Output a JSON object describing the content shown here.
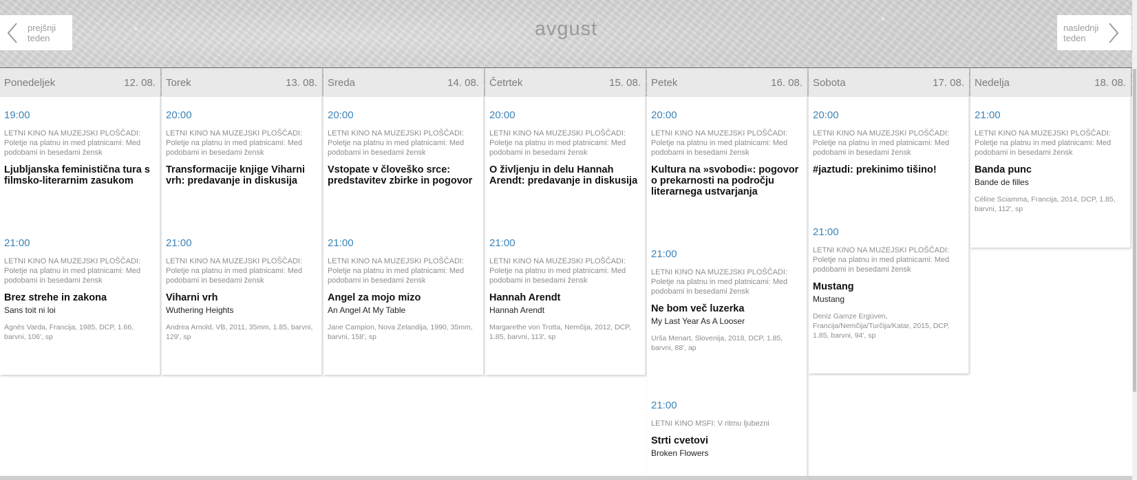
{
  "month": "avgust",
  "nav": {
    "prev_line1": "prejšnji",
    "prev_line2": "teden",
    "next_line1": "naslednji",
    "next_line2": "teden"
  },
  "days": [
    {
      "name": "Ponedeljek",
      "date": "12. 08.",
      "events": [
        {
          "time": "19:00",
          "series": "LETNI KINO NA MUZEJSKI PLOŠČADI: Poletje na platnu in med platnicami: Med podobami in besedami žensk",
          "title": "Ljubljanska feministična tura s filmsko-literarnim zasukom",
          "orig": "",
          "info": ""
        },
        {
          "time": "21:00",
          "series": "LETNI KINO NA MUZEJSKI PLOŠČADI: Poletje na platnu in med platnicami: Med podobami in besedami žensk",
          "title": "Brez strehe in zakona",
          "orig": "Sans toit ni loi",
          "info": "Agnès Varda, Francija, 1985, DCP, 1.66, barvni, 106', sp"
        }
      ]
    },
    {
      "name": "Torek",
      "date": "13. 08.",
      "events": [
        {
          "time": "20:00",
          "series": "LETNI KINO NA MUZEJSKI PLOŠČADI: Poletje na platnu in med platnicami: Med podobami in besedami žensk",
          "title": "Transformacije knjige Viharni vrh: predavanje in diskusija",
          "orig": "",
          "info": ""
        },
        {
          "time": "21:00",
          "series": "LETNI KINO NA MUZEJSKI PLOŠČADI: Poletje na platnu in med platnicami: Med podobami in besedami žensk",
          "title": "Viharni vrh",
          "orig": "Wuthering Heights",
          "info": "Andrea Arnold, VB, 2011, 35mm, 1.85, barvni, 129', sp"
        }
      ]
    },
    {
      "name": "Sreda",
      "date": "14. 08.",
      "events": [
        {
          "time": "20:00",
          "series": "LETNI KINO NA MUZEJSKI PLOŠČADI: Poletje na platnu in med platnicami: Med podobami in besedami žensk",
          "title": "Vstopate v človeško srce: predstavitev zbirke in pogovor",
          "orig": "",
          "info": ""
        },
        {
          "time": "21:00",
          "series": "LETNI KINO NA MUZEJSKI PLOŠČADI: Poletje na platnu in med platnicami: Med podobami in besedami žensk",
          "title": "Angel za mojo mizo",
          "orig": "An Angel At My Table",
          "info": "Jane Campion, Nova Zelandija, 1990, 35mm, barvni, 158', sp"
        }
      ]
    },
    {
      "name": "Četrtek",
      "date": "15. 08.",
      "events": [
        {
          "time": "20:00",
          "series": "LETNI KINO NA MUZEJSKI PLOŠČADI: Poletje na platnu in med platnicami: Med podobami in besedami žensk",
          "title": "O življenju in delu Hannah Arendt: predavanje in diskusija",
          "orig": "",
          "info": ""
        },
        {
          "time": "21:00",
          "series": "LETNI KINO NA MUZEJSKI PLOŠČADI: Poletje na platnu in med platnicami: Med podobami in besedami žensk",
          "title": "Hannah Arendt",
          "orig": "Hannah Arendt",
          "info": "Margarethe von Trotta, Nemčija, 2012, DCP, 1.85, barvni, 113', sp"
        }
      ]
    },
    {
      "name": "Petek",
      "date": "16. 08.",
      "events": [
        {
          "time": "20:00",
          "series": "LETNI KINO NA MUZEJSKI PLOŠČADI: Poletje na platnu in med platnicami: Med podobami in besedami žensk",
          "title": "Kultura na »svobodi«: pogovor o prekarnosti na področju literarnega ustvarjanja",
          "orig": "",
          "info": ""
        },
        {
          "time": "21:00",
          "series": "LETNI KINO NA MUZEJSKI PLOŠČADI: Poletje na platnu in med platnicami: Med podobami in besedami žensk",
          "title": "Ne bom več luzerka",
          "orig": "My Last Year As A Looser",
          "info": "Urša Menart, Slovenija, 2018, DCP, 1.85, barvni, 88', ap"
        },
        {
          "time": "21:00",
          "series": "LETNI KINO MSFI: V ritmu ljubezni",
          "title": "Strti cvetovi",
          "orig": "Broken Flowers",
          "info": ""
        }
      ]
    },
    {
      "name": "Sobota",
      "date": "17. 08.",
      "events": [
        {
          "time": "20:00",
          "series": "LETNI KINO NA MUZEJSKI PLOŠČADI: Poletje na platnu in med platnicami: Med podobami in besedami žensk",
          "title": "#jaztudi: prekinimo tišino!",
          "orig": "",
          "info": ""
        },
        {
          "time": "21:00",
          "series": "LETNI KINO NA MUZEJSKI PLOŠČADI: Poletje na platnu in med platnicami: Med podobami in besedami žensk",
          "title": "Mustang",
          "orig": "Mustang",
          "info": "Deniz Gamze Ergüven, Francija/Nemčija/Turčija/Katar, 2015, DCP, 1.85, barvni, 94', sp"
        }
      ]
    },
    {
      "name": "Nedelja",
      "date": "18. 08.",
      "events": [
        {
          "time": "21:00",
          "series": "LETNI KINO NA MUZEJSKI PLOŠČADI: Poletje na platnu in med platnicami: Med podobami in besedami žensk",
          "title": "Banda punc",
          "orig": "Bande de filles",
          "info": "Céline Sciamma, Francija, 2014, DCP, 1.85, barvni, 112', sp"
        }
      ]
    }
  ]
}
